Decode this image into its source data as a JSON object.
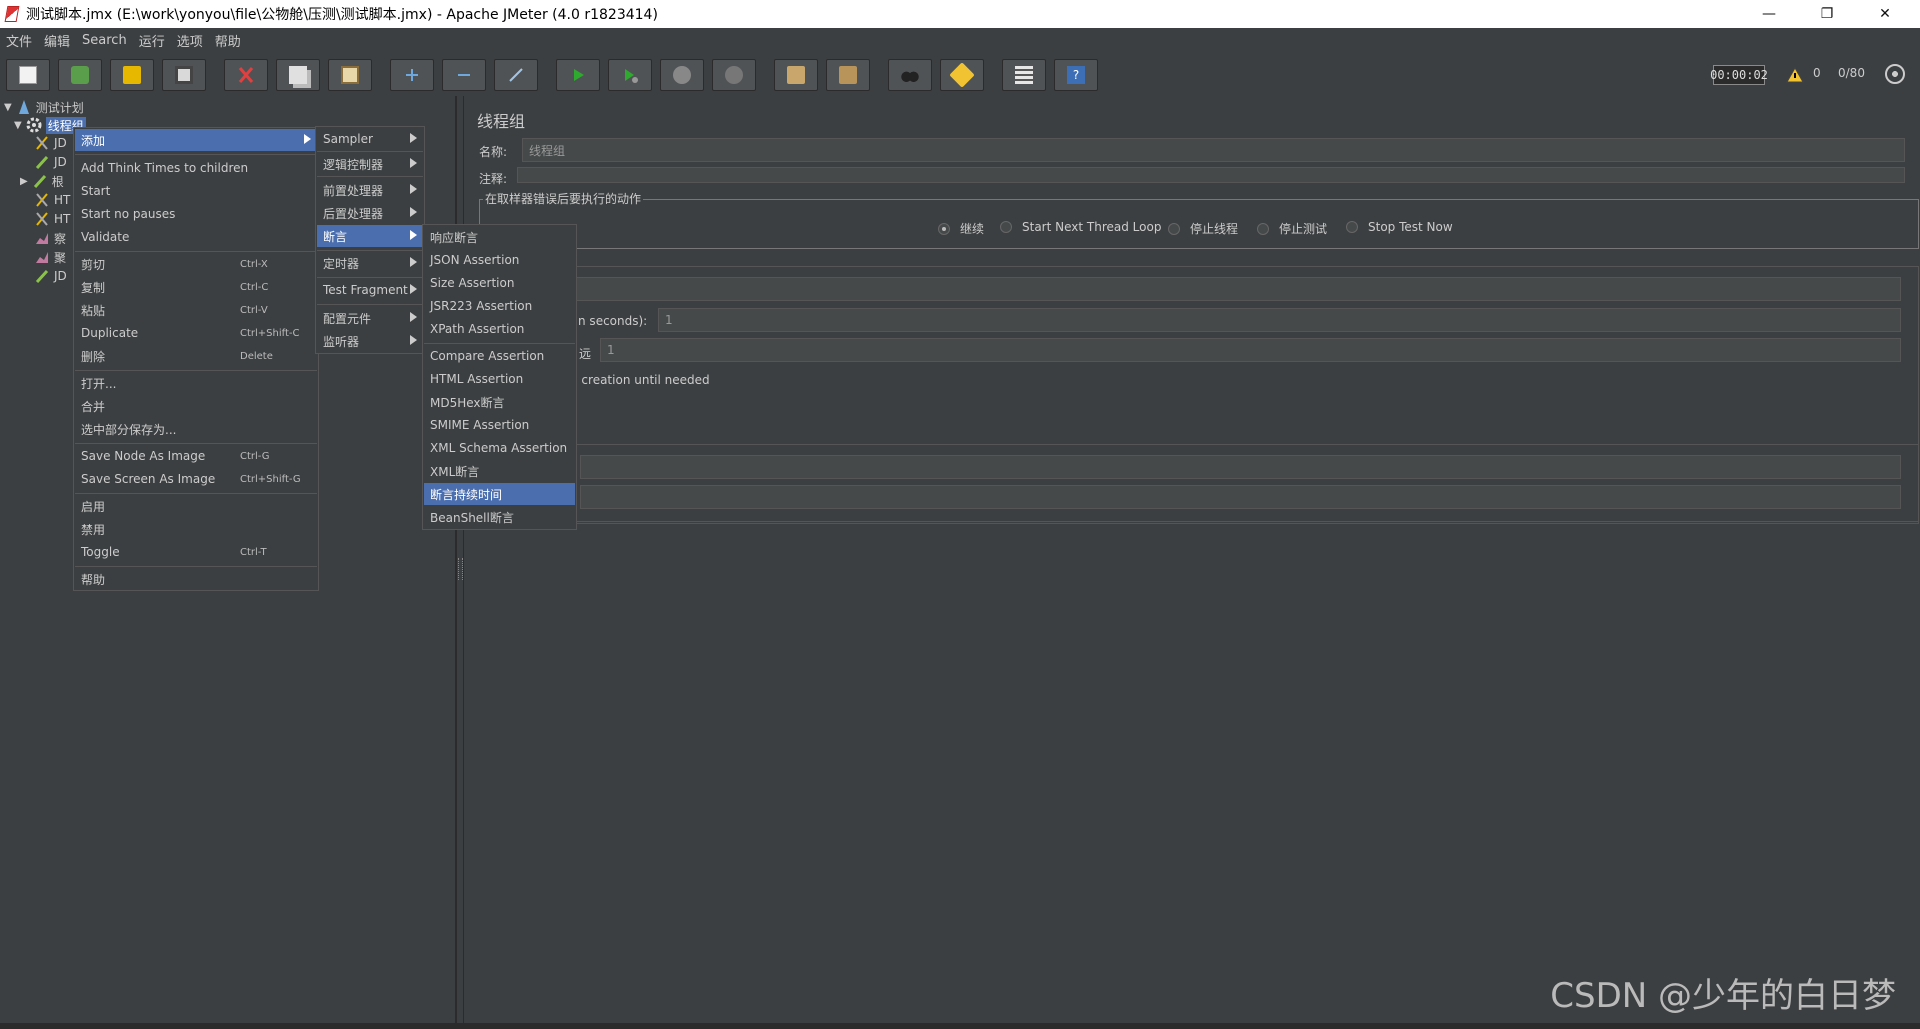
{
  "window": {
    "title": "测试脚本.jmx (E:\\work\\yonyou\\file\\公物舱\\压测\\测试脚本.jmx) - Apache JMeter (4.0 r1823414)",
    "minimize": "—",
    "maximize": "❐",
    "close": "✕"
  },
  "menubar": [
    "文件",
    "编辑",
    "Search",
    "运行",
    "选项",
    "帮助"
  ],
  "toolbar": {
    "timer": "00:00:02",
    "warnings": "0",
    "threads": "0/80"
  },
  "tree": {
    "root": "测试计划",
    "thread_group": "线程组",
    "children": [
      "JD",
      "JD",
      "根",
      "HT",
      "HT",
      "察",
      "聚",
      "JD"
    ]
  },
  "content": {
    "heading": "线程组",
    "name_label": "名称:",
    "name_value": "线程组",
    "comment_label": "注释:",
    "error_group_legend": "在取样器错误后要执行的动作",
    "radio_options": [
      "继续",
      "Start Next Thread Loop",
      "停止线程",
      "停止测试",
      "Stop Test Now"
    ],
    "rampup_label": "(in seconds):",
    "rampup_value": "1",
    "loop_label": "远",
    "loop_value": "1",
    "delay_label": "d creation until needed"
  },
  "menu_main": {
    "items": [
      {
        "label": "添加"
      },
      {
        "label": "Add Think Times to children"
      },
      {
        "label": "Start"
      },
      {
        "label": "Start no pauses"
      },
      {
        "label": "Validate"
      },
      {
        "label": "剪切",
        "shortcut": "Ctrl-X"
      },
      {
        "label": "复制",
        "shortcut": "Ctrl-C"
      },
      {
        "label": "粘贴",
        "shortcut": "Ctrl-V"
      },
      {
        "label": "Duplicate",
        "shortcut": "Ctrl+Shift-C"
      },
      {
        "label": "删除",
        "shortcut": "Delete"
      },
      {
        "label": "打开..."
      },
      {
        "label": "合并"
      },
      {
        "label": "选中部分保存为..."
      },
      {
        "label": "Save Node As Image",
        "shortcut": "Ctrl-G"
      },
      {
        "label": "Save Screen As Image",
        "shortcut": "Ctrl+Shift-G"
      },
      {
        "label": "启用"
      },
      {
        "label": "禁用"
      },
      {
        "label": "Toggle",
        "shortcut": "Ctrl-T"
      },
      {
        "label": "帮助"
      }
    ]
  },
  "menu_add": {
    "items": [
      "Sampler",
      "逻辑控制器",
      "前置处理器",
      "后置处理器",
      "断言",
      "定时器",
      "Test Fragment",
      "配置元件",
      "监听器"
    ]
  },
  "menu_assert": {
    "items": [
      "响应断言",
      "JSON Assertion",
      "Size Assertion",
      "JSR223 Assertion",
      "XPath Assertion",
      "Compare Assertion",
      "HTML Assertion",
      "MD5Hex断言",
      "SMIME Assertion",
      "XML Schema Assertion",
      "XML断言",
      "断言持续时间",
      "BeanShell断言"
    ]
  },
  "watermark": "CSDN @少年的白日梦"
}
